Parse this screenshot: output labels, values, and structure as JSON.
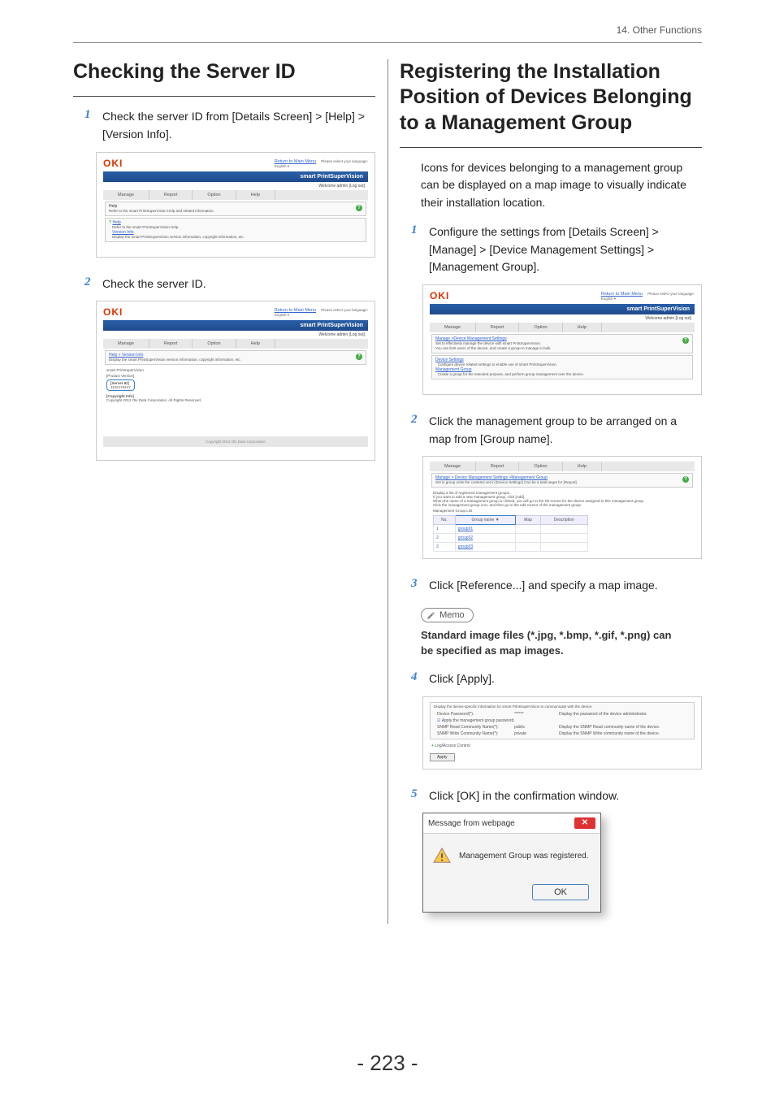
{
  "header": {
    "section": "14. Other Functions"
  },
  "pageNum": "- 223 -",
  "left": {
    "title": "Checking the Server ID",
    "step1": "Check the server ID from [Details Screen] > [Help] > [Version Info].",
    "step2": "Check the server ID."
  },
  "right": {
    "title": "Registering the Installation Position of Devices Belonging to a Management Group",
    "intro": "Icons for devices belonging to a management group can be displayed on a map image to visually indicate their installation location.",
    "step1": "Configure the settings from [Details Screen] > [Manage] > [Device Management Settings] > [Management Group].",
    "step2": "Click the management group to be arranged on a map from [Group name].",
    "step3": "Click [Reference...] and specify a map image.",
    "memoLabel": "Memo",
    "memoText": "Standard image files (*.jpg, *.bmp, *.gif, *.png) can be specified as map images.",
    "step4": "Click [Apply].",
    "step5": "Click [OK] in the confirmation window."
  },
  "shot": {
    "oki": "OKI",
    "returnMain": "Return to Main Menu",
    "langLabel": "Please select your language:",
    "lang": "English",
    "bluebar": "smart PrintSuperVision",
    "welcome": "Welcome admin [Log out]",
    "tabs": {
      "manage": "Manage",
      "report": "Report",
      "option": "Option",
      "help": "Help"
    },
    "help1": {
      "bc": "Help",
      "desc": "Refer to the smart PrintSuperVision Help and related information.",
      "helpLine": "Help",
      "helpSub": "Refer to the smart PrintSuperVision Help.",
      "versionInfo": "Version Info",
      "versionSub": "Display the smart PrintSuperVision version information, copyright information, etc."
    },
    "help2": {
      "bc": "Help > Version Info",
      "desc": "Display the smart PrintSuperVision version information, copyright information, etc.",
      "line1": "smart PrintSuperVision",
      "line2": "[Product Version]",
      "serverIdLabel": "[Server ID]",
      "serverIdVal": "1102176447",
      "copyLabel": "[Copyright Info]",
      "copyVal": "Copyright 2012 Oki Data Corporation. All Rights Reserved.",
      "footer": "Copyright 2012 Oki Data Corporation"
    },
    "mg": {
      "bc": "Manage >Device Management Settings",
      "desc1": "Set to effectively manage the device with smart PrintSuperVision.",
      "desc2": "You can limit users of the device, and create a group to manage in bulk.",
      "devSettings": "Device Settings",
      "devSettingsSub": "Configure device related settings to enable use of smart PrintSuperVision.",
      "mgmtGroup": "Management Group",
      "mgmtGroupSub": "Create a group for the intended purpose, and perform group management over the device."
    },
    "grouplist": {
      "bc": "Manage > Device Management Settings >Management Group",
      "line1": "Set in group units the contents set in [Device Settings] Can be a total target for [Report].",
      "line2a": "Display a list of registered management groups.",
      "line2b": "If you want to add a new management group, click [Add].",
      "line2c": "When the name of a management group is clicked, you will go to the list screen for the device assigned to this management group.",
      "line2d": "Click the management group icon, and then go to the edit screen of the management group.",
      "listLabel": "Management Group List",
      "thNo": "No.",
      "thGroup": "Group name",
      "thMap": "Map",
      "thDesc": "Description",
      "g1": "group01",
      "g2": "group02",
      "g3": "group03"
    },
    "apply": {
      "hdr": "Display the device-specific information for smart PrintSuperVision to communicate with the device.",
      "pwLabel": "Device Password(*):",
      "pwVal": "******",
      "pwDesc": "Display the password of the device administrator.",
      "chk": "Apply the management group password.",
      "readLabel": "SNMP Read Community Name(*):",
      "readVal": "public",
      "readDesc": "Display the SNMP Read community name of the device.",
      "writeLabel": "SNMP Write Community Name(*):",
      "writeVal": "private",
      "writeDesc": "Display the SNMP Write community name of the device.",
      "logAccess": "Log/Access Control",
      "applyBtn": "Apply"
    },
    "dialog": {
      "title": "Message from webpage",
      "msg": "Management Group was registered.",
      "ok": "OK"
    }
  }
}
